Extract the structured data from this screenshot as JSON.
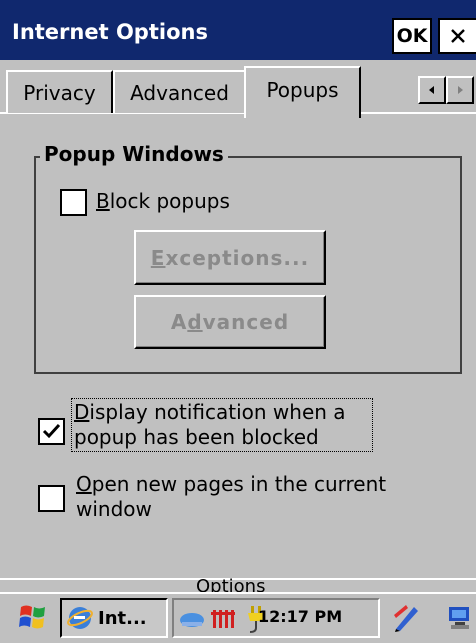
{
  "window": {
    "title": "Internet Options",
    "ok_label": "OK",
    "close_icon": "close-icon"
  },
  "tabs": [
    {
      "label": "Privacy",
      "selected": false
    },
    {
      "label": "Advanced",
      "selected": false
    },
    {
      "label": "Popups",
      "selected": true
    }
  ],
  "tab_scroll": {
    "left_icon": "arrow-left-icon",
    "right_icon": "arrow-right-icon"
  },
  "popup_windows": {
    "group_title": "Popup Windows",
    "block_popups": {
      "label_access": "B",
      "label_rest": "lock popups",
      "checked": false
    },
    "exceptions_button": {
      "access": "E",
      "rest": "xceptions...",
      "enabled": false
    },
    "advanced_button": {
      "pre": "A",
      "access": "d",
      "rest": "vanced",
      "enabled": false
    }
  },
  "options": {
    "display_notification": {
      "access": "D",
      "rest": "isplay notification when a popup has been blocked",
      "checked": true
    },
    "open_new_pages": {
      "access": "O",
      "rest": "pen new pages in the current window",
      "checked": false
    }
  },
  "menu_bar": {
    "label": "Options"
  },
  "taskbar": {
    "start_icon": "windows-flag-icon",
    "task_label": "Int...",
    "task_icon": "internet-explorer-icon",
    "tray_icons": [
      "network-icon",
      "signal-bars-icon",
      "power-plug-icon"
    ],
    "clock": "12:17 PM",
    "input_icon": "input-panel-icon",
    "desktop_icon": "desktop-icon"
  },
  "colors": {
    "titlebar": "#10286e",
    "dialog_background": "#c0c0c0",
    "disabled_text": "#8a8a8a"
  }
}
